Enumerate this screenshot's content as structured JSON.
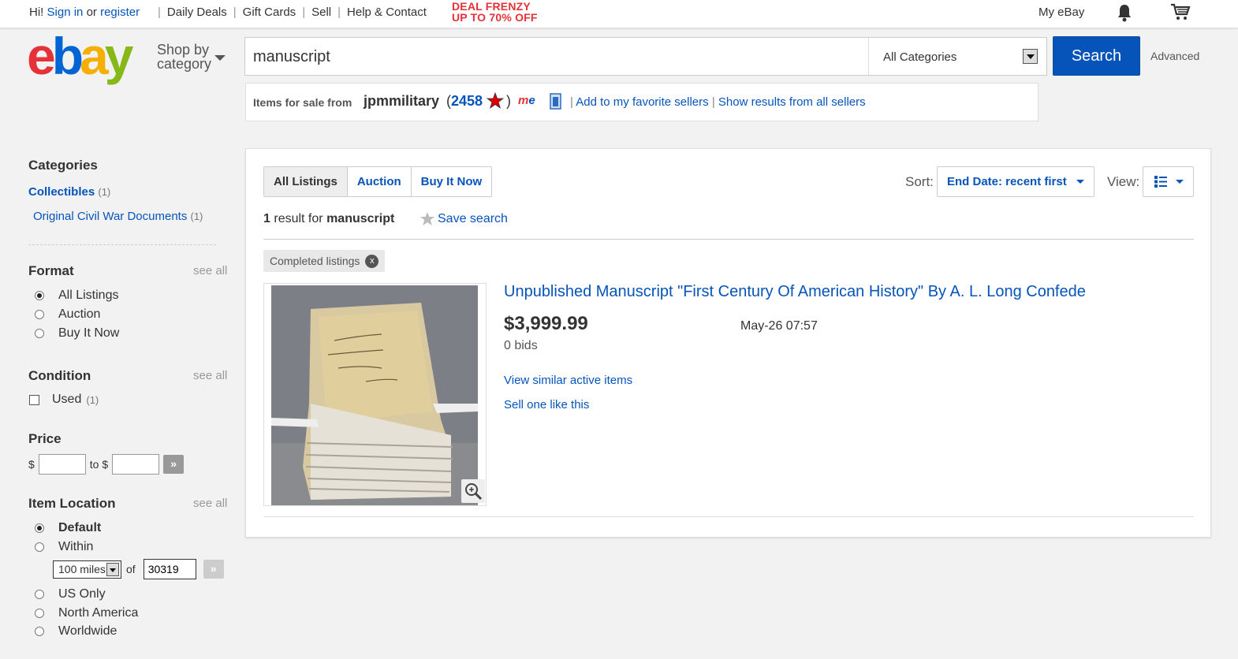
{
  "topbar": {
    "greeting": "Hi!",
    "sign_in": "Sign in",
    "or": "or",
    "register": "register",
    "links": [
      "Daily Deals",
      "Gift Cards",
      "Sell",
      "Help & Contact"
    ],
    "deal_line1": "DEAL FRENZY",
    "deal_line2": "UP TO 70% OFF",
    "my_ebay": "My eBay",
    "icons": [
      "bell-icon",
      "cart-icon"
    ]
  },
  "header": {
    "shop_by_line1": "Shop by",
    "shop_by_line2": "category",
    "search_value": "manuscript",
    "category_selected": "All Categories",
    "search_button": "Search",
    "advanced": "Advanced"
  },
  "seller": {
    "label": "Items for sale from",
    "name": "jpmmilitary",
    "score": "2458",
    "add_favorite": "Add to my favorite sellers",
    "show_all": "Show results from all sellers"
  },
  "sidebar": {
    "categories_title": "Categories",
    "cat1": "Collectibles",
    "cat1_count": "(1)",
    "cat2": "Original Civil War Documents",
    "cat2_count": "(1)",
    "format_title": "Format",
    "see_all": "see all",
    "format_options": [
      "All Listings",
      "Auction",
      "Buy It Now"
    ],
    "condition_title": "Condition",
    "condition_option": "Used",
    "condition_count": "(1)",
    "price_title": "Price",
    "currency": "$",
    "to": "to $",
    "location_title": "Item Location",
    "location_default": "Default",
    "location_within": "Within",
    "miles": "100 miles",
    "of": "of",
    "zip": "30319",
    "location_options": [
      "US Only",
      "North America",
      "Worldwide"
    ]
  },
  "results": {
    "tabs": [
      "All Listings",
      "Auction",
      "Buy It Now"
    ],
    "sort_label": "Sort:",
    "sort_value": "End Date: recent first",
    "view_label": "View:",
    "count_num": "1",
    "count_text": "result for",
    "count_query": "manuscript",
    "save_search": "Save search",
    "chip": "Completed listings",
    "chip_close": "x",
    "item": {
      "title": "Unpublished Manuscript \"First Century Of American History\" By A. L. Long Confede",
      "price": "$3,999.99",
      "bids": "0 bids",
      "end_date": "May-26 07:57",
      "similar": "View similar active items",
      "sell_one": "Sell one like this"
    }
  },
  "colors": {
    "accent": "#0654ba",
    "deal": "#e53238",
    "logo_e": "#e53238",
    "logo_b": "#0064d2",
    "logo_a": "#f5af02",
    "logo_y": "#86b817"
  }
}
